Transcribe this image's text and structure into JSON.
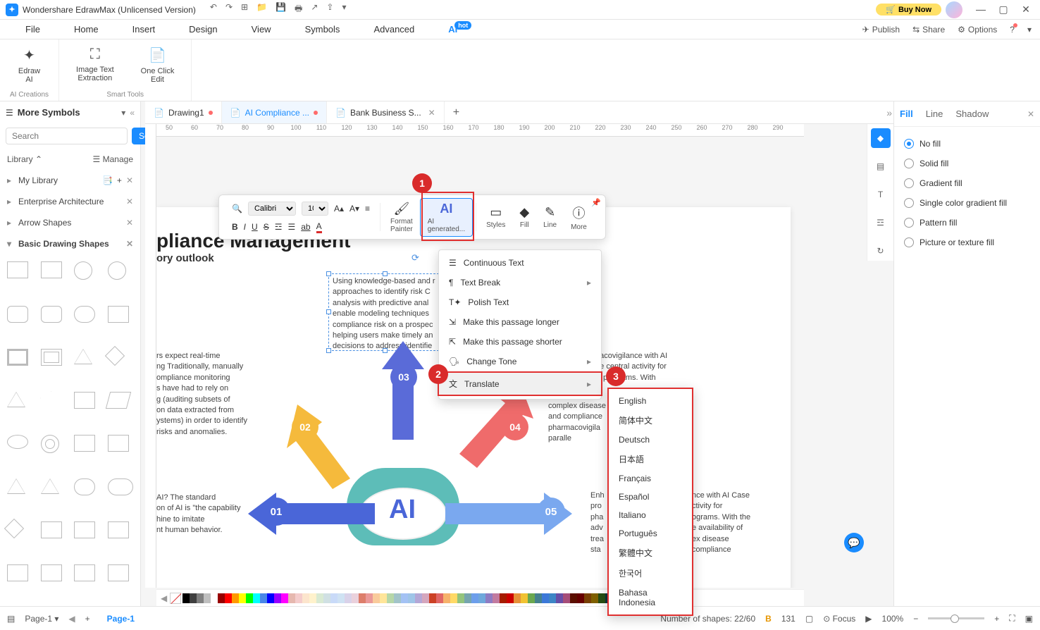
{
  "titlebar": {
    "app_name": "Wondershare EdrawMax (Unlicensed Version)",
    "buy_now": "Buy Now"
  },
  "menubar": {
    "items": [
      "File",
      "Home",
      "Insert",
      "Design",
      "View",
      "Symbols",
      "Advanced",
      "AI"
    ],
    "hot": "hot",
    "right": {
      "publish": "Publish",
      "share": "Share",
      "options": "Options"
    }
  },
  "ribbon": {
    "edraw_ai": "Edraw\nAI",
    "ai_creations": "AI Creations",
    "image_text": "Image Text\nExtraction",
    "one_click": "One Click\nEdit",
    "smart_tools": "Smart Tools"
  },
  "left_panel": {
    "more_symbols": "More Symbols",
    "search_placeholder": "Search",
    "search_btn": "Search",
    "library": "Library",
    "manage": "Manage",
    "cats": [
      "My Library",
      "Enterprise Architecture",
      "Arrow Shapes",
      "Basic Drawing Shapes"
    ]
  },
  "doc_tabs": [
    {
      "label": "Drawing1",
      "active": false,
      "unsaved": true,
      "closeable": false
    },
    {
      "label": "AI Compliance ...",
      "active": true,
      "unsaved": true,
      "closeable": false
    },
    {
      "label": "Bank Business S...",
      "active": false,
      "unsaved": false,
      "closeable": true
    }
  ],
  "ruler_h": [
    50,
    60,
    70,
    80,
    90,
    100,
    110,
    120,
    130,
    140,
    150,
    160,
    170,
    180,
    190,
    200,
    210,
    220,
    230,
    240,
    250,
    260,
    270,
    280,
    290
  ],
  "float_toolbar": {
    "font": "Calibri",
    "size": "10",
    "format_painter": "Format\nPainter",
    "ai_generated": "AI\ngenerated...",
    "styles": "Styles",
    "fill": "Fill",
    "line": "Line",
    "more": "More"
  },
  "ctx_menu": {
    "continuous": "Continuous Text",
    "text_break": "Text Break",
    "polish": "Polish Text",
    "longer": "Make this passage longer",
    "shorter": "Make this passage shorter",
    "tone": "Change Tone",
    "translate": "Translate"
  },
  "languages": [
    "English",
    "简体中文",
    "Deutsch",
    "日本語",
    "Français",
    "Español",
    "Italiano",
    "Português",
    "繁體中文",
    "한국어",
    "Bahasa Indonesia"
  ],
  "right_panel": {
    "tabs": [
      "Fill",
      "Line",
      "Shadow"
    ],
    "options": [
      "No fill",
      "Solid fill",
      "Gradient fill",
      "Single color gradient fill",
      "Pattern fill",
      "Picture or texture fill"
    ],
    "selected": 0
  },
  "canvas": {
    "title_fragment": "pliance Management",
    "subtitle": "ory outlook",
    "selected_text": "Using knowledge-based and r\napproaches to identify risk C\nanalysis with predictive anal\nenable modeling techniques\ncompliance risk on a prospec\nhelping users make timely an\ndecisions to address identifie",
    "left_block": "rs expect real-time\nng Traditionally, manually\nompliance monitoring\ns have had to rely on\ng (auditing subsets of\non data extracted from\nystems) in order to identify\nrisks and anomalies.",
    "left_block2": "AI? The standard\non of AI is \"the capability\nhine to imitate\nnt human behavior.",
    "right_block": "macovigilance with AI\nthe central activity for\nV) programs. With",
    "right_block2": "complex disease\nand compliance\npharmacovigila\nparalle",
    "right_block3": "Enh\npro\npha\nadv\ntrea\nsta",
    "right_block3b": "nce with AI Case\nctivity for\nograms. With the\ne availability of\nex disease\ncompliance"
  },
  "statusbar": {
    "page_list": "Page-1",
    "page_tab": "Page-1",
    "shapes_count": "Number of shapes: 22/60",
    "coord": "131",
    "focus": "Focus",
    "zoom": "100%"
  },
  "steps": [
    "1",
    "2",
    "3"
  ]
}
